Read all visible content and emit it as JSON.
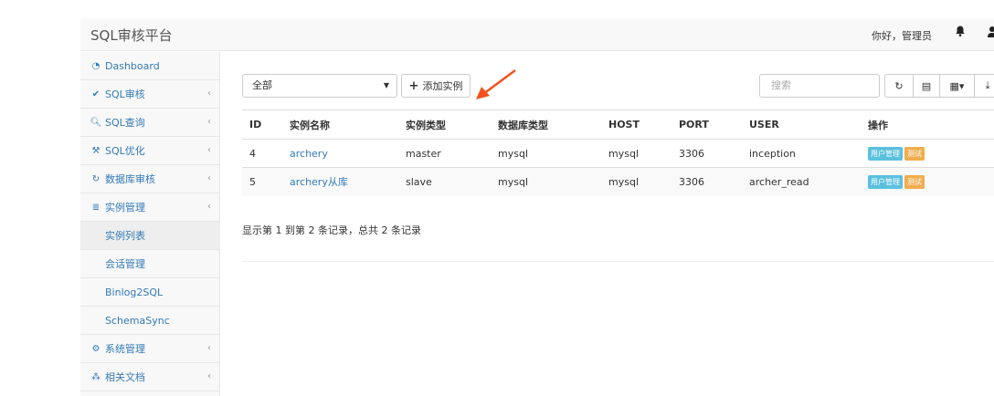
{
  "navbar": {
    "brand": "SQL审核平台",
    "greeting": "你好，管理员"
  },
  "sidebar": {
    "items": [
      {
        "label": "Dashboard",
        "icon": "dashboard-icon",
        "chevron": false
      },
      {
        "label": "SQL审核",
        "icon": "check-icon",
        "chevron": true
      },
      {
        "label": "SQL查询",
        "icon": "search-icon",
        "chevron": true
      },
      {
        "label": "SQL优化",
        "icon": "wrench-icon",
        "chevron": true
      },
      {
        "label": "数据库审核",
        "icon": "refresh-icon",
        "chevron": true
      },
      {
        "label": "实例管理",
        "icon": "database-icon",
        "chevron": true
      },
      {
        "label": "实例列表"
      },
      {
        "label": "会话管理"
      },
      {
        "label": "Binlog2SQL"
      },
      {
        "label": "SchemaSync"
      },
      {
        "label": "系统管理",
        "icon": "cogs-icon",
        "chevron": true
      },
      {
        "label": "相关文档",
        "icon": "sitemap-icon",
        "chevron": true
      }
    ]
  },
  "toolbar": {
    "filter_value": "全部",
    "add_label": "添加实例",
    "search_placeholder": "搜索"
  },
  "table": {
    "headers": [
      "ID",
      "实例名称",
      "实例类型",
      "数据库类型",
      "HOST",
      "PORT",
      "USER",
      "操作"
    ],
    "rows": [
      {
        "id": "4",
        "name": "archery",
        "type": "master",
        "db_type": "mysql",
        "host": "mysql",
        "port": "3306",
        "user": "inception",
        "actions": [
          "用户管理",
          "测试"
        ]
      },
      {
        "id": "5",
        "name": "archery从库",
        "type": "slave",
        "db_type": "mysql",
        "host": "mysql",
        "port": "3306",
        "user": "archer_read",
        "actions": [
          "用户管理",
          "测试"
        ]
      }
    ]
  },
  "pagination": {
    "info": "显示第 1 到第 2 条记录，总共 2 条记录"
  },
  "colors": {
    "link": "#337ab7",
    "badge_user": "#5bc0de",
    "badge_test": "#f0ad4e",
    "arrow": "#f4511e"
  }
}
